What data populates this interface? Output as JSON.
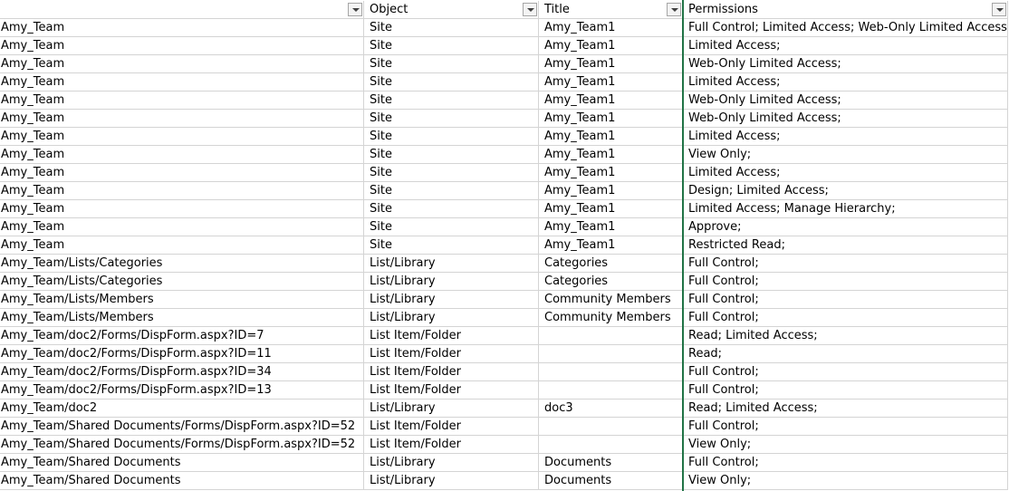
{
  "header": {
    "col_a": "",
    "col_b": "Object",
    "col_c": "Title",
    "col_d": "Permissions"
  },
  "rows": [
    [
      "Amy_Team",
      "Site",
      "Amy_Team1",
      "Full Control; Limited Access; Web-Only Limited Access;"
    ],
    [
      "Amy_Team",
      "Site",
      "Amy_Team1",
      "Limited Access;"
    ],
    [
      "Amy_Team",
      "Site",
      "Amy_Team1",
      "Web-Only Limited Access;"
    ],
    [
      "Amy_Team",
      "Site",
      "Amy_Team1",
      "Limited Access;"
    ],
    [
      "Amy_Team",
      "Site",
      "Amy_Team1",
      "Web-Only Limited Access;"
    ],
    [
      "Amy_Team",
      "Site",
      "Amy_Team1",
      "Web-Only Limited Access;"
    ],
    [
      "Amy_Team",
      "Site",
      "Amy_Team1",
      "Limited Access;"
    ],
    [
      "Amy_Team",
      "Site",
      "Amy_Team1",
      "View Only;"
    ],
    [
      "Amy_Team",
      "Site",
      "Amy_Team1",
      "Limited Access;"
    ],
    [
      "Amy_Team",
      "Site",
      "Amy_Team1",
      "Design; Limited Access;"
    ],
    [
      "Amy_Team",
      "Site",
      "Amy_Team1",
      "Limited Access; Manage Hierarchy;"
    ],
    [
      "Amy_Team",
      "Site",
      "Amy_Team1",
      "Approve;"
    ],
    [
      "Amy_Team",
      "Site",
      "Amy_Team1",
      "Restricted Read;"
    ],
    [
      "Amy_Team/Lists/Categories",
      "List/Library",
      "Categories",
      "Full Control;"
    ],
    [
      "Amy_Team/Lists/Categories",
      "List/Library",
      "Categories",
      "Full Control;"
    ],
    [
      "Amy_Team/Lists/Members",
      "List/Library",
      "Community Members",
      "Full Control;"
    ],
    [
      "Amy_Team/Lists/Members",
      "List/Library",
      "Community Members",
      "Full Control;"
    ],
    [
      "Amy_Team/doc2/Forms/DispForm.aspx?ID=7",
      "List Item/Folder",
      "",
      "Read; Limited Access;"
    ],
    [
      "Amy_Team/doc2/Forms/DispForm.aspx?ID=11",
      "List Item/Folder",
      "",
      "Read;"
    ],
    [
      "Amy_Team/doc2/Forms/DispForm.aspx?ID=34",
      "List Item/Folder",
      "",
      "Full Control;"
    ],
    [
      "Amy_Team/doc2/Forms/DispForm.aspx?ID=13",
      "List Item/Folder",
      "",
      "Full Control;"
    ],
    [
      "Amy_Team/doc2",
      "List/Library",
      "doc3",
      "Read; Limited Access;"
    ],
    [
      "Amy_Team/Shared Documents/Forms/DispForm.aspx?ID=52",
      "List Item/Folder",
      "",
      "Full Control;"
    ],
    [
      "Amy_Team/Shared Documents/Forms/DispForm.aspx?ID=52",
      "List Item/Folder",
      "",
      "View Only;"
    ],
    [
      "Amy_Team/Shared Documents",
      "List/Library",
      "Documents",
      "Full Control;"
    ],
    [
      "Amy_Team/Shared Documents",
      "List/Library",
      "Documents",
      "View Only;"
    ]
  ],
  "icons": {
    "filter": "filter-dropdown-icon"
  },
  "colors": {
    "grid_line": "#d4d4d4",
    "selection": "#217346"
  }
}
